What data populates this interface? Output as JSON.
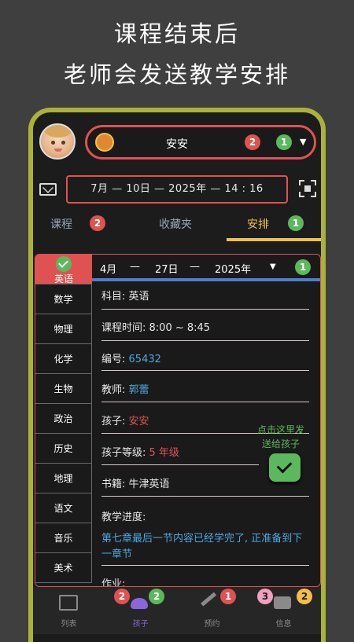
{
  "promo": {
    "line1": "课程结束后",
    "line2": "老师会发送教学安排"
  },
  "header": {
    "child_name": "安安",
    "badge_red": "2",
    "badge_green": "1",
    "datetime": "7月 — 10日 — 2025年 — 14 : 16"
  },
  "tabs": [
    {
      "label": "课程",
      "badge": "2"
    },
    {
      "label": "收藏夹"
    },
    {
      "label": "安排",
      "badge": "1"
    }
  ],
  "subjects": [
    "英语",
    "数学",
    "物理",
    "化学",
    "生物",
    "政治",
    "历史",
    "地理",
    "语文",
    "音乐",
    "美术"
  ],
  "date_header": {
    "month": "4月",
    "day": "27日",
    "year": "2025年",
    "badge": "1",
    "sep": "—"
  },
  "detail": {
    "subject_label": "科目:",
    "subject_value": "英语",
    "time_label": "课程时间:",
    "time_value": "8:00 ~ 8:45",
    "number_label": "编号:",
    "number_value": "65432",
    "teacher_label": "教师:",
    "teacher_value": "郭蕾",
    "child_label": "孩子:",
    "child_value": "安安",
    "grade_label": "孩子等级:",
    "grade_value": "5 年级",
    "book_label": "书籍:",
    "book_value": "牛津英语",
    "progress_label": "教学进度:",
    "progress_value": "第七章最后一节内容已经学完了, 正准备到下一章节",
    "homework_label": "作业:"
  },
  "send_note": "点击这里发送给孩子",
  "bottom_nav": [
    {
      "label": "列表"
    },
    {
      "label": "孩子",
      "badges": [
        "2",
        "2"
      ]
    },
    {
      "label": "预约",
      "badges": [
        "1"
      ]
    },
    {
      "label": "信息",
      "badges": [
        "3",
        "2"
      ]
    }
  ],
  "colors": {
    "accent_red": "#e05252",
    "accent_green": "#5cb85c",
    "accent_yellow": "#f1c04a",
    "link_blue": "#4fa7e0",
    "frame": "#a9b23a"
  }
}
